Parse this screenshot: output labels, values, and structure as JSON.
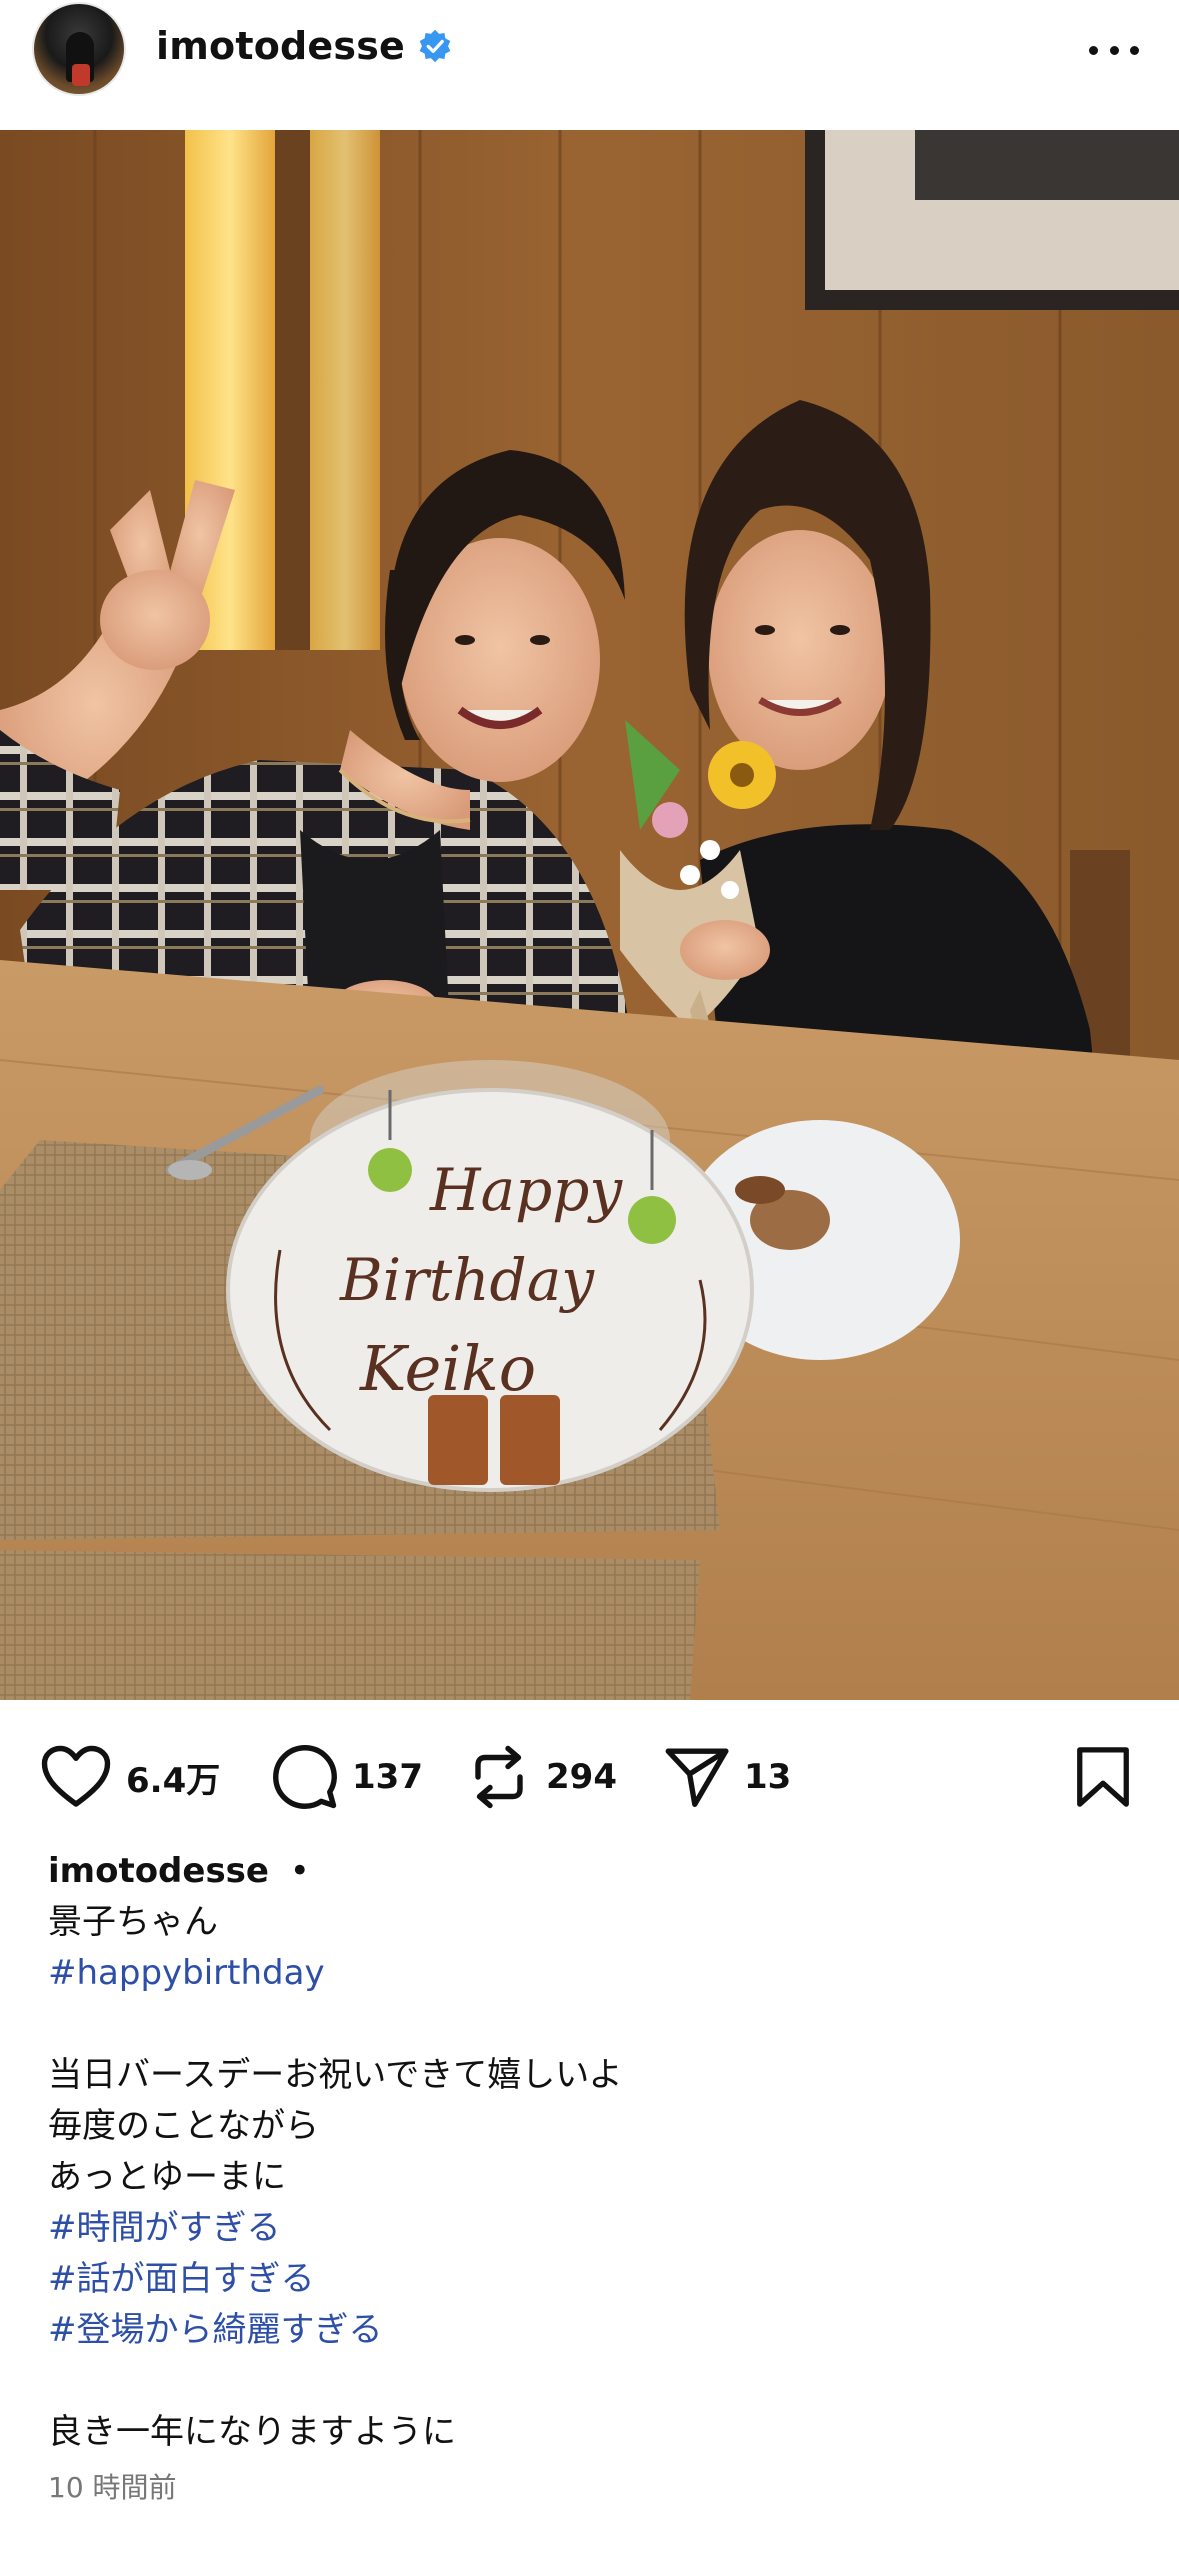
{
  "header": {
    "username": "imotodesse",
    "verified": true,
    "more_icon": "more-horizontal-icon",
    "avatar_icon": "profile-avatar"
  },
  "photo": {
    "cake_plate_text": [
      "Happy",
      "Birthday",
      "Keiko"
    ]
  },
  "actions": {
    "like": {
      "icon": "heart-icon",
      "count": "6.4万"
    },
    "comment": {
      "icon": "comment-icon",
      "count": "137"
    },
    "repost": {
      "icon": "repost-icon",
      "count": "294"
    },
    "share": {
      "icon": "send-icon",
      "count": "13"
    },
    "save": {
      "icon": "bookmark-icon"
    }
  },
  "caption": {
    "author": "imotodesse",
    "separator": "•",
    "line1": "景子ちゃん",
    "hashtag1": "#happybirthday",
    "line2": "当日バースデーお祝いできて嬉しいよ",
    "line3": "毎度のことながら",
    "line4": "あっとゆーまに",
    "hashtag2": "#時間がすぎる",
    "hashtag3": "#話が面白すぎる",
    "hashtag4": "#登場から綺麗すぎる",
    "line5": "良き一年になりますように"
  },
  "timestamp": "10 時間前",
  "colors": {
    "hashtag": "#2e4fa8",
    "verified": "#3897f0",
    "text": "#111111",
    "muted": "#777777"
  }
}
